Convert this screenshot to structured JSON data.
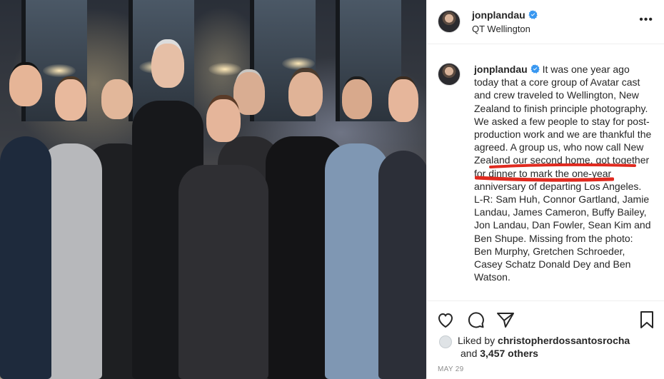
{
  "photo": {
    "alt": ""
  },
  "header": {
    "username": "jonplandau",
    "location": "QT Wellington",
    "more_label": "•••"
  },
  "caption": {
    "username": "jonplandau",
    "text": "It was one year ago today that a core group of Avatar cast and crew traveled to Wellington, New Zealand to finish principle photography. We asked a few people to stay for post-production work and we are thankful the agreed. A group us, who now call New Zealand our second home, got together for dinner to mark the one-year anniversary of departing Los Angeles. L-R: Sam Huh, Connor Gartland, Jamie Landau, James Cameron, Buffy Bailey, Jon Landau, Dan Fowler, Sean Kim and Ben Shupe. Missing from the photo: Ben Murphy, Gretchen Schroeder, Casey Schatz Donald Dey and Ben Watson."
  },
  "annotation": {
    "color": "#e02a1f"
  },
  "actions": {
    "like_icon": "heart-icon",
    "comment_icon": "comment-icon",
    "share_icon": "share-icon",
    "save_icon": "bookmark-icon"
  },
  "likes": {
    "prefix": "Liked by",
    "user": "christopherdossantosrocha",
    "and": "and",
    "others": "3,457 others"
  },
  "date": "MAY 29",
  "colors": {
    "verified": "#3897f0",
    "text": "#262626",
    "muted": "#8e8e8e",
    "border": "#efefef"
  }
}
